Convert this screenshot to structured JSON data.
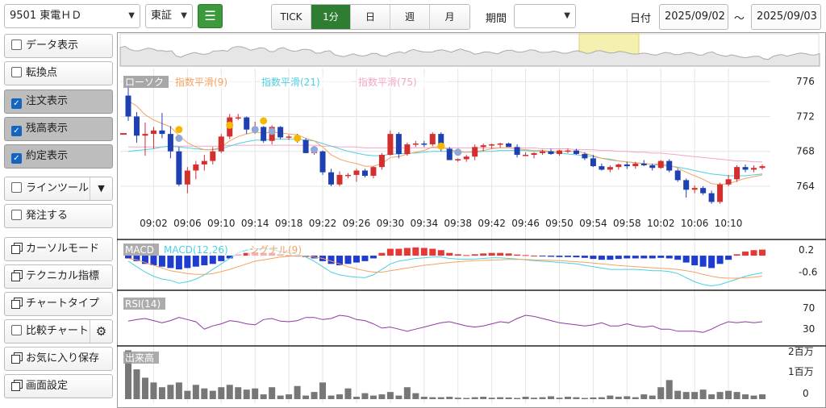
{
  "header": {
    "stock_select": "9501 東電ＨＤ",
    "market_select": "東証",
    "tabs": [
      "TICK",
      "1分",
      "日",
      "週",
      "月"
    ],
    "active_tab": "1分",
    "period_label": "期間",
    "period_select": "",
    "date_label": "日付",
    "date_from": "2025/09/02",
    "date_sep": "～",
    "date_to": "2025/09/03"
  },
  "sidebar": {
    "items": [
      {
        "label": "データ表示",
        "kind": "checkbox",
        "checked": false
      },
      {
        "label": "転換点",
        "kind": "checkbox",
        "checked": false
      },
      {
        "label": "注文表示",
        "kind": "checkbox",
        "checked": true
      },
      {
        "label": "残高表示",
        "kind": "checkbox",
        "checked": true
      },
      {
        "label": "約定表示",
        "kind": "checkbox",
        "checked": true
      },
      {
        "label": "ラインツール",
        "kind": "checkbox",
        "checked": false
      },
      {
        "label": "発注する",
        "kind": "checkbox",
        "checked": false
      },
      {
        "label": "カーソルモード",
        "kind": "window"
      },
      {
        "label": "テクニカル指標",
        "kind": "window"
      },
      {
        "label": "チャートタイプ",
        "kind": "window"
      },
      {
        "label": "比較チャート",
        "kind": "checkbox",
        "checked": false
      },
      {
        "label": "お気に入り保存",
        "kind": "window"
      },
      {
        "label": "画面設定",
        "kind": "window"
      }
    ]
  },
  "colors": {
    "up": "#d32f2f",
    "down": "#1e40b0",
    "ema9": "#f4a261",
    "ema21": "#4dd0e1",
    "ema75": "#f3a6c8",
    "rsi": "#8e3a9e",
    "volume": "#777777",
    "macd_line": "#4dd0e1",
    "signal_line": "#f4a261",
    "macd_hist_up": "#e53935",
    "macd_hist_down": "#1e3cd0",
    "accent": "#2e7d32"
  },
  "chart_data": {
    "type": "candlestick",
    "legend": [
      "ローソク",
      "指数平滑(9)",
      "指数平滑(21)",
      "指数平滑(75)"
    ],
    "y_ticks": [
      776,
      772,
      768,
      764
    ],
    "ylim": [
      761.5,
      777.5
    ],
    "x_ticks": [
      "09:02",
      "09:06",
      "09:10",
      "09:14",
      "09:18",
      "09:22",
      "09:26",
      "09:30",
      "09:34",
      "09:38",
      "09:42",
      "09:46",
      "09:50",
      "09:54",
      "09:58",
      "10:02",
      "10:06",
      "10:10"
    ],
    "ohlc": [
      [
        774.4,
        776.2,
        771.5,
        772.0
      ],
      [
        772.0,
        772.5,
        769.0,
        769.8
      ],
      [
        769.8,
        771.3,
        767.5,
        770.0
      ],
      [
        770.0,
        770.8,
        768.3,
        770.4
      ],
      [
        770.4,
        772.4,
        769.5,
        770.0
      ],
      [
        770.0,
        770.9,
        767.2,
        768.0
      ],
      [
        768.0,
        768.5,
        764.0,
        764.2
      ],
      [
        764.2,
        766.2,
        763.2,
        765.8
      ],
      [
        765.8,
        766.9,
        764.8,
        766.5
      ],
      [
        766.5,
        767.6,
        765.8,
        766.9
      ],
      [
        766.9,
        768.5,
        766.5,
        768.0
      ],
      [
        768.0,
        770.0,
        767.8,
        769.7
      ],
      [
        769.7,
        772.3,
        769.4,
        771.9
      ],
      [
        771.9,
        772.3,
        771.6,
        771.9
      ],
      [
        771.9,
        772.0,
        770.0,
        770.5
      ],
      [
        770.5,
        771.4,
        770.0,
        770.8
      ],
      [
        770.8,
        770.9,
        769.0,
        769.2
      ],
      [
        769.2,
        771.0,
        768.8,
        770.8
      ],
      [
        770.8,
        770.9,
        769.4,
        769.6
      ],
      [
        769.6,
        769.9,
        769.3,
        769.7
      ],
      [
        769.7,
        770.0,
        769.0,
        769.3
      ],
      [
        769.3,
        769.5,
        767.8,
        767.8
      ],
      [
        767.8,
        768.5,
        767.6,
        768.0
      ],
      [
        768.0,
        768.1,
        765.3,
        765.6
      ],
      [
        765.6,
        766.0,
        764.0,
        764.2
      ],
      [
        764.2,
        765.7,
        764.0,
        765.3
      ],
      [
        765.3,
        765.5,
        764.9,
        765.3
      ],
      [
        765.3,
        766.0,
        764.5,
        765.8
      ],
      [
        765.8,
        766.0,
        765.0,
        765.2
      ],
      [
        765.2,
        766.3,
        764.9,
        766.2
      ],
      [
        766.2,
        767.8,
        765.9,
        767.6
      ],
      [
        767.6,
        770.4,
        767.5,
        770.0
      ],
      [
        770.0,
        770.2,
        767.2,
        767.7
      ],
      [
        767.7,
        769.0,
        767.5,
        768.8
      ],
      [
        768.8,
        769.2,
        768.5,
        768.9
      ],
      [
        768.9,
        769.2,
        768.5,
        768.8
      ],
      [
        768.8,
        770.2,
        768.6,
        770.0
      ],
      [
        770.0,
        770.2,
        768.0,
        768.3
      ],
      [
        768.3,
        768.5,
        767.0,
        767.0
      ],
      [
        767.0,
        767.2,
        766.8,
        767.1
      ],
      [
        767.1,
        767.6,
        766.8,
        767.4
      ],
      [
        767.4,
        768.8,
        767.0,
        768.5
      ],
      [
        768.5,
        768.9,
        768.0,
        768.7
      ],
      [
        768.7,
        768.9,
        768.3,
        768.8
      ],
      [
        768.8,
        769.0,
        768.4,
        768.9
      ],
      [
        768.9,
        769.0,
        768.5,
        768.5
      ],
      [
        768.5,
        768.8,
        767.3,
        767.6
      ],
      [
        767.6,
        767.9,
        767.5,
        767.6
      ],
      [
        767.6,
        767.9,
        767.2,
        767.8
      ],
      [
        767.8,
        768.2,
        767.6,
        768.0
      ],
      [
        768.0,
        768.3,
        767.6,
        767.7
      ],
      [
        767.7,
        768.2,
        767.5,
        768.1
      ],
      [
        768.1,
        768.3,
        767.8,
        768.1
      ],
      [
        768.1,
        768.3,
        767.6,
        767.7
      ],
      [
        767.7,
        767.9,
        767.0,
        767.2
      ],
      [
        767.2,
        767.6,
        766.2,
        766.3
      ],
      [
        766.3,
        766.6,
        765.8,
        765.9
      ],
      [
        765.9,
        766.4,
        765.6,
        766.2
      ],
      [
        766.2,
        766.6,
        765.9,
        766.5
      ],
      [
        766.5,
        766.8,
        766.0,
        766.3
      ],
      [
        766.3,
        766.8,
        766.0,
        766.6
      ],
      [
        766.6,
        767.0,
        766.3,
        766.4
      ],
      [
        766.4,
        766.6,
        765.8,
        766.1
      ],
      [
        766.1,
        767.0,
        766.0,
        766.9
      ],
      [
        766.9,
        767.1,
        765.6,
        765.8
      ],
      [
        765.8,
        766.0,
        764.5,
        764.7
      ],
      [
        764.7,
        764.9,
        762.7,
        763.6
      ],
      [
        763.6,
        764.1,
        763.2,
        763.8
      ],
      [
        763.8,
        764.0,
        763.0,
        763.2
      ],
      [
        763.2,
        763.5,
        762.0,
        762.2
      ],
      [
        762.2,
        764.4,
        762.0,
        764.2
      ],
      [
        764.2,
        765.3,
        764.0,
        764.8
      ],
      [
        764.8,
        766.4,
        764.5,
        766.2
      ],
      [
        766.2,
        766.5,
        765.6,
        765.9
      ],
      [
        765.9,
        766.4,
        765.6,
        766.1
      ],
      [
        766.1,
        766.5,
        765.9,
        766.3
      ]
    ],
    "ema9": [
      773.8,
      773.2,
      772.2,
      771.6,
      771.2,
      770.8,
      769.8,
      769.0,
      768.5,
      768.2,
      768.2,
      768.5,
      769.2,
      769.7,
      770.0,
      770.2,
      770.1,
      770.2,
      770.1,
      770.0,
      769.9,
      769.5,
      769.2,
      768.5,
      767.6,
      767.1,
      766.8,
      766.6,
      766.3,
      766.3,
      766.6,
      767.3,
      767.4,
      767.7,
      767.9,
      768.1,
      768.5,
      768.5,
      768.2,
      768.0,
      767.9,
      768.0,
      768.1,
      768.3,
      768.4,
      768.4,
      768.3,
      768.2,
      768.1,
      768.1,
      768.0,
      768.0,
      768.0,
      768.0,
      767.8,
      767.5,
      767.2,
      767.0,
      766.9,
      766.8,
      766.7,
      766.6,
      766.5,
      766.6,
      766.4,
      766.1,
      765.6,
      765.2,
      764.8,
      764.3,
      764.2,
      764.3,
      764.6,
      764.9,
      765.1,
      765.3
    ],
    "ema21": [
      768.0,
      768.1,
      768.2,
      768.3,
      768.5,
      768.6,
      768.5,
      768.4,
      768.3,
      768.2,
      768.2,
      768.3,
      768.6,
      768.9,
      769.1,
      769.3,
      769.3,
      769.4,
      769.4,
      769.4,
      769.4,
      769.3,
      769.2,
      768.9,
      768.6,
      768.3,
      768.0,
      767.8,
      767.6,
      767.5,
      767.5,
      767.7,
      767.7,
      767.8,
      767.8,
      767.9,
      768.0,
      768.0,
      768.0,
      767.9,
      767.9,
      767.9,
      768.0,
      768.0,
      768.1,
      768.1,
      768.1,
      768.1,
      768.0,
      768.0,
      767.9,
      767.8,
      767.7,
      767.6,
      767.5,
      767.4,
      767.2,
      767.1,
      766.9,
      766.8,
      766.7,
      766.6,
      766.5,
      766.4,
      766.3,
      766.2,
      766.0,
      765.8,
      765.6,
      765.4,
      765.3,
      765.2,
      765.2,
      765.2,
      765.3,
      765.4
    ],
    "ema75": [
      768.5,
      768.5,
      768.5,
      768.5,
      768.5,
      768.6,
      768.6,
      768.6,
      768.6,
      768.6,
      768.6,
      768.6,
      768.7,
      768.7,
      768.7,
      768.7,
      768.7,
      768.7,
      768.7,
      768.7,
      768.7,
      768.7,
      768.7,
      768.6,
      768.6,
      768.5,
      768.5,
      768.5,
      768.4,
      768.4,
      768.4,
      768.4,
      768.4,
      768.4,
      768.4,
      768.4,
      768.4,
      768.4,
      768.4,
      768.4,
      768.4,
      768.4,
      768.4,
      768.4,
      768.4,
      768.4,
      768.4,
      768.4,
      768.4,
      768.3,
      768.3,
      768.3,
      768.3,
      768.2,
      768.2,
      768.2,
      768.1,
      768.1,
      768.0,
      768.0,
      767.9,
      767.9,
      767.8,
      767.8,
      767.7,
      767.6,
      767.5,
      767.4,
      767.3,
      767.2,
      767.1,
      767.0,
      766.9,
      766.9,
      766.8,
      766.8
    ],
    "markers": [
      {
        "i": 6,
        "p": 770.5,
        "c": "#f5b800"
      },
      {
        "i": 6,
        "p": 769.5,
        "c": "#8fa8d8"
      },
      {
        "i": 12,
        "p": 771.0,
        "c": "#f5b800"
      },
      {
        "i": 15,
        "p": 770.5,
        "c": "#8fa8d8"
      },
      {
        "i": 16,
        "p": 771.5,
        "c": "#f5b800"
      },
      {
        "i": 17,
        "p": 770.3,
        "c": "#8fa8d8"
      },
      {
        "i": 20,
        "p": 769.5,
        "c": "#f5b800"
      },
      {
        "i": 22,
        "p": 768.2,
        "c": "#8fa8d8"
      },
      {
        "i": 37,
        "p": 768.6,
        "c": "#f5b800"
      },
      {
        "i": 39,
        "p": 767.9,
        "c": "#8fa8d8"
      }
    ],
    "macd": {
      "label": "MACD",
      "params_label": "MACD(12,26)",
      "signal_label": "シグナル(9)",
      "ticks": [
        "0.2",
        "-0.6"
      ],
      "ylim": [
        -1.2,
        0.5
      ],
      "hist": [
        -0.1,
        -0.2,
        -0.3,
        -0.35,
        -0.4,
        -0.45,
        -0.5,
        -0.45,
        -0.4,
        -0.35,
        -0.3,
        -0.2,
        -0.1,
        0.05,
        0.1,
        0.12,
        0.1,
        0.1,
        0.05,
        0.02,
        0.0,
        -0.05,
        -0.1,
        -0.2,
        -0.3,
        -0.35,
        -0.3,
        -0.25,
        -0.2,
        -0.1,
        0.1,
        0.25,
        0.25,
        0.28,
        0.3,
        0.28,
        0.25,
        0.2,
        0.1,
        0.05,
        0.02,
        0.05,
        0.08,
        0.1,
        0.1,
        0.08,
        0.04,
        0.02,
        0.0,
        -0.02,
        -0.04,
        -0.05,
        -0.05,
        -0.06,
        -0.08,
        -0.12,
        -0.15,
        -0.15,
        -0.12,
        -0.1,
        -0.1,
        -0.1,
        -0.1,
        -0.08,
        -0.1,
        -0.15,
        -0.25,
        -0.35,
        -0.4,
        -0.45,
        -0.3,
        -0.15,
        0.05,
        0.15,
        0.2,
        0.22
      ],
      "line": [
        -0.2,
        -0.4,
        -0.6,
        -0.75,
        -0.85,
        -0.9,
        -1.0,
        -0.95,
        -0.85,
        -0.7,
        -0.5,
        -0.3,
        -0.1,
        0.1,
        0.2,
        0.25,
        0.25,
        0.22,
        0.15,
        0.1,
        0.05,
        -0.05,
        -0.2,
        -0.4,
        -0.6,
        -0.7,
        -0.75,
        -0.78,
        -0.8,
        -0.7,
        -0.5,
        -0.3,
        -0.2,
        -0.15,
        -0.1,
        -0.08,
        -0.05,
        -0.05,
        -0.1,
        -0.12,
        -0.13,
        -0.12,
        -0.1,
        -0.08,
        -0.08,
        -0.1,
        -0.12,
        -0.15,
        -0.18,
        -0.2,
        -0.22,
        -0.25,
        -0.27,
        -0.3,
        -0.35,
        -0.4,
        -0.45,
        -0.5,
        -0.5,
        -0.5,
        -0.5,
        -0.52,
        -0.55,
        -0.55,
        -0.58,
        -0.65,
        -0.8,
        -0.95,
        -1.05,
        -1.1,
        -1.05,
        -0.95,
        -0.85,
        -0.75,
        -0.68,
        -0.62
      ],
      "signal": [
        -0.1,
        -0.15,
        -0.25,
        -0.35,
        -0.45,
        -0.55,
        -0.6,
        -0.65,
        -0.68,
        -0.68,
        -0.65,
        -0.58,
        -0.5,
        -0.4,
        -0.3,
        -0.2,
        -0.15,
        -0.1,
        -0.05,
        -0.02,
        0.0,
        -0.02,
        -0.05,
        -0.1,
        -0.2,
        -0.3,
        -0.4,
        -0.48,
        -0.55,
        -0.6,
        -0.6,
        -0.55,
        -0.5,
        -0.45,
        -0.4,
        -0.35,
        -0.32,
        -0.28,
        -0.25,
        -0.22,
        -0.2,
        -0.18,
        -0.17,
        -0.16,
        -0.15,
        -0.14,
        -0.14,
        -0.14,
        -0.15,
        -0.16,
        -0.17,
        -0.18,
        -0.2,
        -0.22,
        -0.24,
        -0.27,
        -0.3,
        -0.33,
        -0.36,
        -0.38,
        -0.4,
        -0.42,
        -0.44,
        -0.46,
        -0.48,
        -0.5,
        -0.55,
        -0.6,
        -0.68,
        -0.75,
        -0.8,
        -0.82,
        -0.82,
        -0.8,
        -0.78,
        -0.75
      ]
    },
    "rsi": {
      "label": "RSI(14)",
      "ticks": [
        "70",
        "30"
      ],
      "ylim": [
        0,
        100
      ],
      "values": [
        45,
        48,
        50,
        46,
        42,
        46,
        52,
        48,
        44,
        30,
        36,
        40,
        46,
        44,
        40,
        38,
        48,
        50,
        45,
        44,
        46,
        52,
        52,
        48,
        50,
        56,
        54,
        48,
        46,
        40,
        32,
        34,
        30,
        26,
        30,
        34,
        38,
        42,
        44,
        40,
        36,
        34,
        36,
        40,
        44,
        42,
        50,
        56,
        54,
        50,
        46,
        42,
        40,
        38,
        36,
        38,
        42,
        36,
        36,
        40,
        36,
        34,
        36,
        30,
        30,
        26,
        26,
        26,
        24,
        30,
        38,
        44,
        42,
        44,
        42,
        44
      ]
    },
    "volume": {
      "label": "出来高",
      "ticks": [
        "2百万",
        "1百万",
        "0"
      ],
      "ylim": [
        0,
        2.2
      ],
      "values": [
        2.05,
        1.25,
        0.9,
        0.7,
        0.5,
        0.6,
        0.7,
        0.35,
        0.6,
        0.45,
        0.35,
        0.5,
        0.6,
        0.5,
        0.4,
        0.45,
        0.2,
        0.5,
        0.15,
        0.2,
        0.55,
        0.15,
        0.3,
        0.7,
        0.15,
        0.2,
        0.45,
        0.1,
        0.25,
        0.15,
        0.2,
        0.3,
        0.15,
        0.5,
        0.25,
        0.1,
        0.08,
        0.08,
        0.1,
        0.06,
        0.05,
        0.08,
        0.1,
        0.06,
        0.08,
        0.07,
        0.05,
        0.1,
        0.06,
        0.08,
        0.12,
        0.06,
        0.1,
        0.08,
        0.05,
        0.07,
        0.08,
        0.15,
        0.1,
        0.12,
        0.08,
        0.2,
        0.15,
        0.5,
        0.8,
        0.35,
        0.3,
        0.3,
        0.4,
        0.2,
        0.3,
        0.35,
        0.3,
        0.2,
        0.15,
        0.2
      ]
    },
    "overview": {
      "highlight_label": ""
    }
  }
}
